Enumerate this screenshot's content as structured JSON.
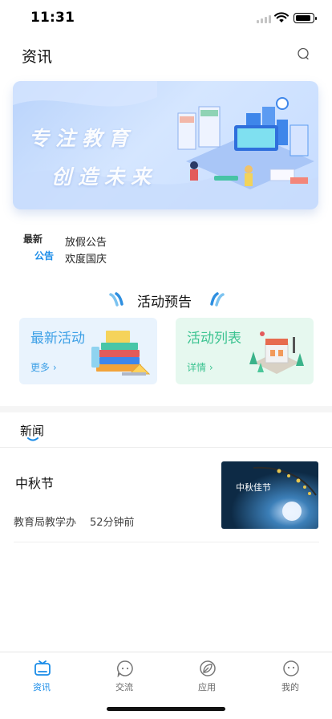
{
  "status_bar": {
    "time": "11:31",
    "icons": [
      "signal-icon",
      "wifi-icon",
      "battery-icon"
    ]
  },
  "header": {
    "title": "资讯",
    "right_icon": "chat-bubble-icon"
  },
  "banner": {
    "line1": "专注教育",
    "line2": "创造未来",
    "colors": {
      "bg_start": "#b9d3fb",
      "bg_end": "#c6dcff"
    }
  },
  "notice": {
    "logo_top": "最新",
    "logo_bottom": "公告",
    "items": [
      "放假公告",
      "欢度国庆"
    ]
  },
  "activity_section": {
    "title": "活动预告",
    "cards": [
      {
        "title": "最新活动",
        "link": "更多 ›",
        "bg": "#e9f3fd",
        "accent": "#3ea0e6"
      },
      {
        "title": "活动列表",
        "link": "详情 ›",
        "bg": "#e6f8ef",
        "accent": "#3cc391"
      }
    ]
  },
  "news": {
    "tab_label": "新闻",
    "items": [
      {
        "title": "中秋节",
        "source": "教育局教学办",
        "time": "52分钟前",
        "thumb_text": "中秋佳节"
      }
    ]
  },
  "tabbar": {
    "items": [
      {
        "label": "资讯",
        "icon": "tv-icon",
        "active": true
      },
      {
        "label": "交流",
        "icon": "chat-icon",
        "active": false
      },
      {
        "label": "应用",
        "icon": "leaf-icon",
        "active": false
      },
      {
        "label": "我的",
        "icon": "smiley-icon",
        "active": false
      }
    ],
    "accent": "#1a8ce8"
  }
}
